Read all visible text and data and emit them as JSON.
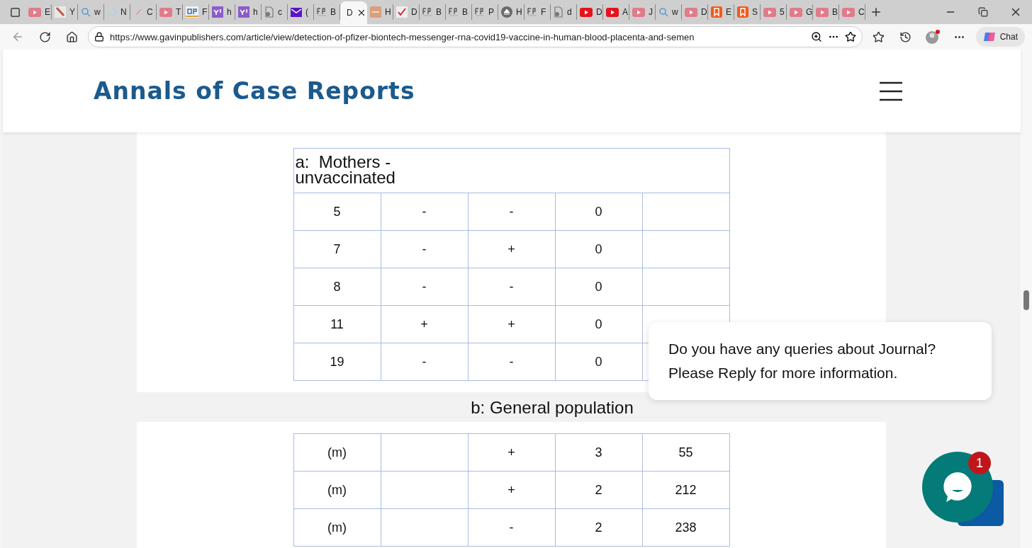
{
  "tabs": [
    {
      "kind": "ytpink",
      "title": "E",
      "selected": false
    },
    {
      "kind": "pen",
      "title": "Y",
      "selected": false
    },
    {
      "kind": "search",
      "title": "w",
      "selected": false
    },
    {
      "kind": "loader",
      "title": "N",
      "selected": false
    },
    {
      "kind": "leaf",
      "title": "C",
      "selected": false
    },
    {
      "kind": "ytpink",
      "title": "T",
      "selected": false
    },
    {
      "kind": "gp",
      "title": "F",
      "selected": false
    },
    {
      "kind": "yahoo",
      "title": "h",
      "selected": false
    },
    {
      "kind": "yahoo",
      "title": "h",
      "selected": false
    },
    {
      "kind": "doc",
      "title": "c",
      "selected": false
    },
    {
      "kind": "mail",
      "title": "(",
      "selected": false
    },
    {
      "kind": "fp",
      "title": "B",
      "selected": false
    },
    {
      "kind": "plain",
      "title": "D",
      "selected": true
    },
    {
      "kind": "thm",
      "title": "H",
      "selected": false
    },
    {
      "kind": "check",
      "title": "D",
      "selected": false
    },
    {
      "kind": "fp",
      "title": "B",
      "selected": false
    },
    {
      "kind": "fp",
      "title": "B",
      "selected": false
    },
    {
      "kind": "fp",
      "title": "P",
      "selected": false
    },
    {
      "kind": "circle",
      "title": "H",
      "selected": false
    },
    {
      "kind": "fp",
      "title": "F",
      "selected": false
    },
    {
      "kind": "doc",
      "title": "d",
      "selected": false
    },
    {
      "kind": "ytred",
      "title": "D",
      "selected": false
    },
    {
      "kind": "ytred",
      "title": "A",
      "selected": false
    },
    {
      "kind": "ytpink",
      "title": "J",
      "selected": false
    },
    {
      "kind": "search",
      "title": "w",
      "selected": false
    },
    {
      "kind": "ytpink",
      "title": "D",
      "selected": false
    },
    {
      "kind": "bookmark",
      "title": "E",
      "selected": false
    },
    {
      "kind": "bookmark",
      "title": "S",
      "selected": false
    },
    {
      "kind": "ytpink",
      "title": "5",
      "selected": false
    },
    {
      "kind": "ytpink",
      "title": "G",
      "selected": false
    },
    {
      "kind": "ytpink",
      "title": "B",
      "selected": false
    },
    {
      "kind": "ytpink",
      "title": "C",
      "selected": false
    }
  ],
  "address_bar": {
    "url": "https://www.gavinpublishers.com/article/view/detection-of-pfizer-biontech-messenger-rna-covid19-vaccine-in-human-blood-placenta-and-semen",
    "chat_button": "Chat"
  },
  "site_header": {
    "title": "Annals of Case Reports"
  },
  "table_a": {
    "title": "a:  Mothers - unvaccinated",
    "rows": [
      [
        "5",
        "-",
        "-",
        "0",
        null
      ],
      [
        "7",
        "-",
        "+",
        "0",
        null
      ],
      [
        "8",
        "-",
        "-",
        "0",
        null
      ],
      [
        "11",
        "+",
        "+",
        "0",
        null
      ],
      [
        "19",
        "-",
        "-",
        "0",
        null
      ]
    ]
  },
  "table_b": {
    "caption": "b: General population",
    "rows": [
      [
        "(m)",
        null,
        "+",
        "3",
        "55"
      ],
      [
        "(m)",
        null,
        "+",
        "2",
        "212"
      ],
      [
        "(m)",
        null,
        "-",
        "2",
        "238"
      ]
    ]
  },
  "chat_popup": {
    "lines": [
      "Do you have any queries about Journal?",
      "Please Reply for more information."
    ]
  },
  "chat_badge": "1"
}
